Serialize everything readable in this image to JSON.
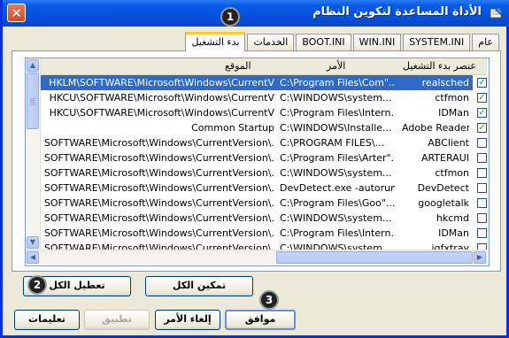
{
  "window": {
    "title": "الأداة المساعدة لتكوين النظام",
    "close_glyph": "✕"
  },
  "tabs": [
    {
      "label": "عام",
      "active": false
    },
    {
      "label": "SYSTEM.INI",
      "active": false
    },
    {
      "label": "WIN.INI",
      "active": false
    },
    {
      "label": "BOOT.INI",
      "active": false
    },
    {
      "label": "الخدمات",
      "active": false
    },
    {
      "label": "بدء التشغيل",
      "active": true
    }
  ],
  "startup_list": {
    "headers": {
      "item": "عنصر بدء التشغيل",
      "command": "الأمر",
      "location": "الموقع"
    },
    "rows": [
      {
        "item": "realsched",
        "command": "C:\\Program Files\\Com\"...",
        "location": "HKLM\\SOFTWARE\\Microsoft\\Windows\\CurrentV",
        "checked": true,
        "selected": true
      },
      {
        "item": "ctfmon",
        "command": "C:\\WINDOWS\\system...",
        "location": "HKCU\\SOFTWARE\\Microsoft\\Windows\\CurrentV",
        "checked": true,
        "selected": false
      },
      {
        "item": "IDMan",
        "command": "C:\\Program Files\\Intern...",
        "location": "HKCU\\SOFTWARE\\Microsoft\\Windows\\CurrentV",
        "checked": true,
        "selected": false
      },
      {
        "item": "Adobe Reader Spe...",
        "command": "C:\\WINDOWS\\Installe...",
        "location": "Common Startup",
        "checked": true,
        "selected": false
      },
      {
        "item": "ABClient",
        "command": "C:\\PROGRAM FILES\\...",
        "location": "SOFTWARE\\Microsoft\\Windows\\CurrentVersion\\.",
        "checked": false,
        "selected": false
      },
      {
        "item": "ARTERAUI",
        "command": "C:\\Program Files\\Arter\"...",
        "location": "SOFTWARE\\Microsoft\\Windows\\CurrentVersion\\.",
        "checked": false,
        "selected": false
      },
      {
        "item": "ctfmon",
        "command": "C:\\WINDOWS\\system...",
        "location": "SOFTWARE\\Microsoft\\Windows\\CurrentVersion\\.",
        "checked": false,
        "selected": false
      },
      {
        "item": "DevDetect",
        "command": "DevDetect.exe -autorun",
        "location": "SOFTWARE\\Microsoft\\Windows\\CurrentVersion\\.",
        "checked": false,
        "selected": false
      },
      {
        "item": "googletalk",
        "command": "C:\\Program Files\\Goo\"...",
        "location": "SOFTWARE\\Microsoft\\Windows\\CurrentVersion\\.",
        "checked": false,
        "selected": false
      },
      {
        "item": "hkcmd",
        "command": "C:\\WINDOWS\\system...",
        "location": "SOFTWARE\\Microsoft\\Windows\\CurrentVersion\\.",
        "checked": false,
        "selected": false
      },
      {
        "item": "IDMan",
        "command": "C:\\Program Files\\Intern...",
        "location": "SOFTWARE\\Microsoft\\Windows\\CurrentVersion\\.",
        "checked": false,
        "selected": false
      },
      {
        "item": "igfxtray",
        "command": "C:\\WINDOWS\\system...",
        "location": "SOFTWARE\\Microsoft\\Windows\\CurrentVersion\\.",
        "checked": false,
        "selected": false
      }
    ]
  },
  "buttons": {
    "enable_all": "تمكين الكل",
    "disable_all": "تعطيل الكل",
    "ok": "موافق",
    "cancel": "إلغاء الأمر",
    "apply": "تطبيق",
    "help": "تعليمات"
  },
  "badges": [
    "1",
    "2",
    "3"
  ],
  "colors": {
    "titlebar": "#0550dc",
    "selection": "#316ac5",
    "active_tab_accent": "#ffc83c",
    "check_green": "#21a121"
  }
}
